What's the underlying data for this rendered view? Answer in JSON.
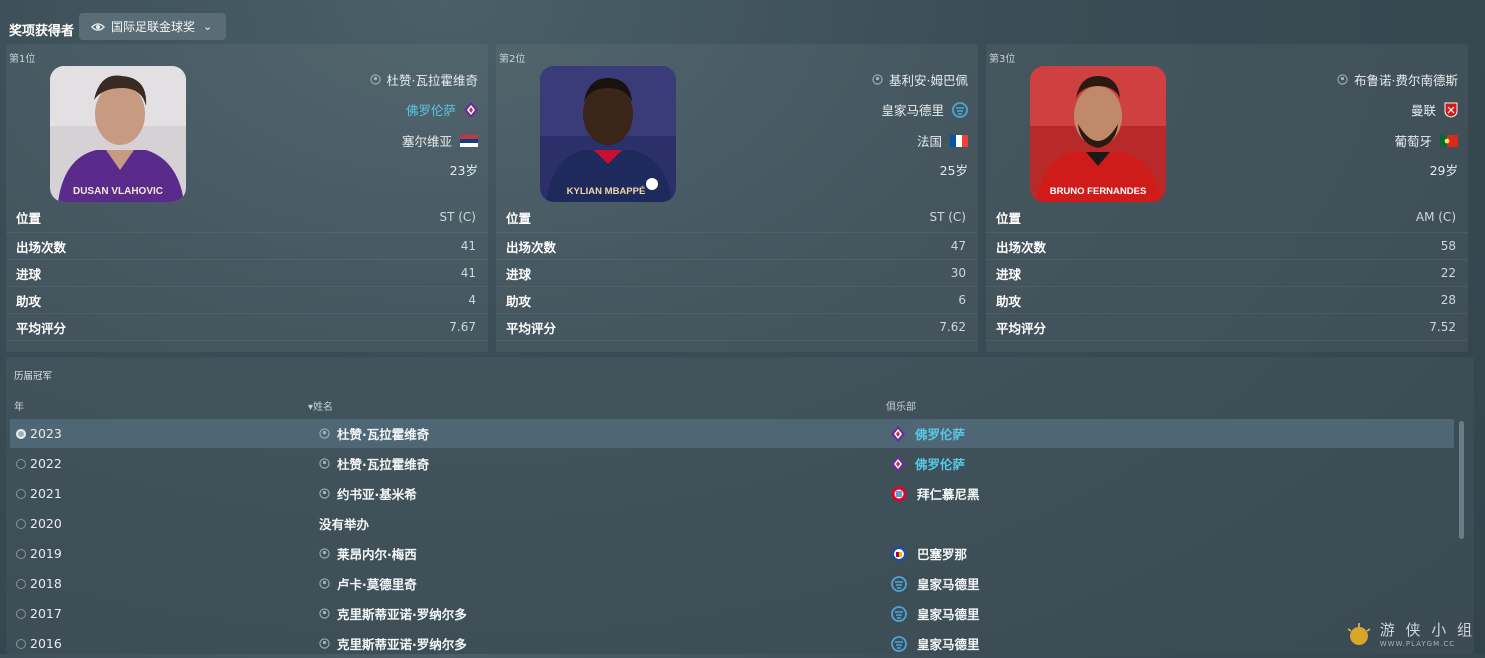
{
  "header": {
    "title": "奖项获得者",
    "award_selector": "国际足联金球奖"
  },
  "podium": [
    {
      "rank": "第1位",
      "player": "杜赞·瓦拉霍维奇",
      "club": "佛罗伦萨",
      "club_is_link": true,
      "nationality": "塞尔维亚",
      "age": "23岁",
      "jersey_text": "DUSAN VLAHOVIC",
      "stats": [
        {
          "label": "位置",
          "value": "ST (C)"
        },
        {
          "label": "出场次数",
          "value": "41"
        },
        {
          "label": "进球",
          "value": "41"
        },
        {
          "label": "助攻",
          "value": "4"
        },
        {
          "label": "平均评分",
          "value": "7.67"
        }
      ]
    },
    {
      "rank": "第2位",
      "player": "基利安·姆巴佩",
      "club": "皇家马德里",
      "club_is_link": false,
      "nationality": "法国",
      "age": "25岁",
      "jersey_text": "KYLIAN MBAPPÉ",
      "stats": [
        {
          "label": "位置",
          "value": "ST (C)"
        },
        {
          "label": "出场次数",
          "value": "47"
        },
        {
          "label": "进球",
          "value": "30"
        },
        {
          "label": "助攻",
          "value": "6"
        },
        {
          "label": "平均评分",
          "value": "7.62"
        }
      ]
    },
    {
      "rank": "第3位",
      "player": "布鲁诺·费尔南德斯",
      "club": "曼联",
      "club_is_link": false,
      "nationality": "葡萄牙",
      "age": "29岁",
      "jersey_text": "BRUNO FERNANDES",
      "stats": [
        {
          "label": "位置",
          "value": "AM (C)"
        },
        {
          "label": "出场次数",
          "value": "58"
        },
        {
          "label": "进球",
          "value": "22"
        },
        {
          "label": "助攻",
          "value": "28"
        },
        {
          "label": "平均评分",
          "value": "7.52"
        }
      ]
    }
  ],
  "history": {
    "title": "历届冠军",
    "columns": {
      "year": "年",
      "name": "姓名",
      "club": "俱乐部"
    },
    "rows": [
      {
        "year": "2023",
        "name": "杜赞·瓦拉霍维奇",
        "club": "佛罗伦萨",
        "club_icon": "fiorentina-crest-icon",
        "selected": true
      },
      {
        "year": "2022",
        "name": "杜赞·瓦拉霍维奇",
        "club": "佛罗伦萨",
        "club_icon": "fiorentina-crest-icon",
        "selected": false
      },
      {
        "year": "2021",
        "name": "约书亚·基米希",
        "club": "拜仁慕尼黑",
        "club_icon": "bayern-crest-icon",
        "selected": false
      },
      {
        "year": "2020",
        "name": "没有举办",
        "club": "",
        "club_icon": "",
        "selected": false
      },
      {
        "year": "2019",
        "name": "莱昂内尔·梅西",
        "club": "巴塞罗那",
        "club_icon": "barcelona-crest-icon",
        "selected": false
      },
      {
        "year": "2018",
        "name": "卢卡·莫德里奇",
        "club": "皇家马德里",
        "club_icon": "real-madrid-crest-icon",
        "selected": false
      },
      {
        "year": "2017",
        "name": "克里斯蒂亚诺·罗纳尔多",
        "club": "皇家马德里",
        "club_icon": "real-madrid-crest-icon",
        "selected": false
      },
      {
        "year": "2016",
        "name": "克里斯蒂亚诺·罗纳尔多",
        "club": "皇家马德里",
        "club_icon": "real-madrid-crest-icon",
        "selected": false
      }
    ]
  },
  "watermark": {
    "text": "游 侠 小 组",
    "sub": "WWW.PLAYGM.CC"
  }
}
